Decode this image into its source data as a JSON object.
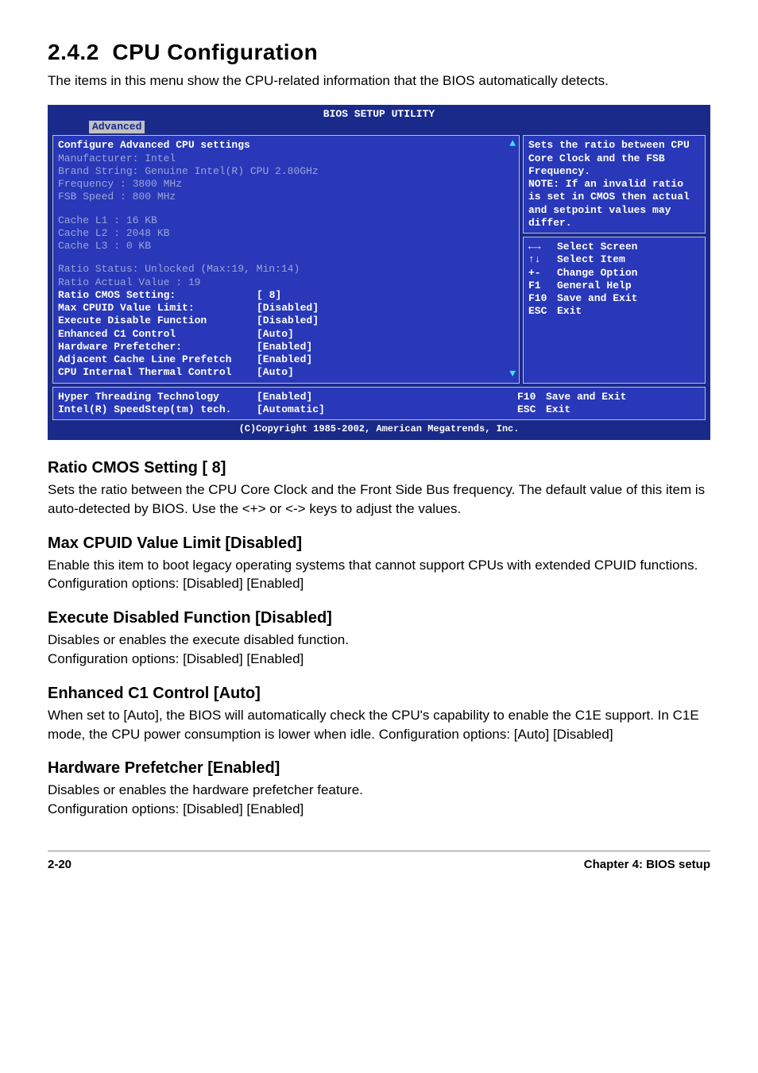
{
  "section": {
    "number": "2.4.2",
    "title": "CPU Configuration",
    "intro": "The items in this menu show the CPU-related information that the BIOS automatically detects."
  },
  "bios": {
    "title": "BIOS SETUP UTILITY",
    "tab": "Advanced",
    "left_heading": "Configure Advanced CPU settings",
    "info": {
      "manufacturer_label": "Manufacturer: Intel",
      "brand_label": "Brand String: Genuine Intel(R) CPU 2.80GHz",
      "frequency_label": "Frequency    : 3800 MHz",
      "fsb_label": "FSB Speed    : 800 MHz",
      "l1_label": "Cache L1     : 16 KB",
      "l2_label": "Cache L2     : 2048 KB",
      "l3_label": "Cache L3     : 0 KB",
      "ratio_status": "Ratio Status: Unlocked (Max:19, Min:14)",
      "ratio_actual": "Ratio Actual Value : 19"
    },
    "items": [
      {
        "label": " Ratio CMOS Setting:",
        "value": "[ 8]"
      },
      {
        "label": "Max CPUID Value Limit:",
        "value": "[Disabled]"
      },
      {
        "label": "Execute Disable Function",
        "value": "[Disabled]"
      },
      {
        "label": "Enhanced C1 Control",
        "value": "[Auto]"
      },
      {
        "label": "Hardware Prefetcher:",
        "value": "[Enabled]"
      },
      {
        "label": "Adjacent Cache Line Prefetch",
        "value": "[Enabled]"
      },
      {
        "label": "CPU Internal Thermal Control",
        "value": "[Auto]"
      }
    ],
    "extra_items": [
      {
        "label": "Hyper Threading Technology",
        "value": "[Enabled]"
      },
      {
        "label": "Intel(R) SpeedStep(tm) tech.",
        "value": "[Automatic]"
      }
    ],
    "help_text": "Sets the ratio between CPU Core Clock and the FSB Frequency.\nNOTE: If an invalid ratio is set in CMOS then actual and setpoint values may differ.",
    "nav_keys": [
      {
        "key": "←→",
        "desc": "Select Screen"
      },
      {
        "key": "↑↓",
        "desc": "Select Item"
      },
      {
        "key": "+-",
        "desc": "Change Option"
      },
      {
        "key": "F1",
        "desc": "General Help"
      },
      {
        "key": "F10",
        "desc": "Save and Exit"
      },
      {
        "key": "ESC",
        "desc": "Exit"
      }
    ],
    "extra_nav": [
      {
        "key": "F10",
        "desc": "Save and Exit"
      },
      {
        "key": "ESC",
        "desc": "Exit"
      }
    ],
    "copyright": "(C)Copyright 1985-2002, American Megatrends, Inc."
  },
  "settings": [
    {
      "heading": "Ratio CMOS Setting [ 8]",
      "body": "Sets the ratio between the CPU Core Clock and the Front Side Bus frequency. The default value of this item is auto-detected by BIOS. Use the <+> or <-> keys to adjust the values."
    },
    {
      "heading": "Max CPUID Value Limit [Disabled]",
      "body": "Enable this item to boot legacy operating systems that cannot support CPUs with extended CPUID functions.\nConfiguration options: [Disabled] [Enabled]"
    },
    {
      "heading": "Execute Disabled Function [Disabled]",
      "body": "Disables or enables the execute disabled function.\nConfiguration options: [Disabled] [Enabled]"
    },
    {
      "heading": "Enhanced C1 Control [Auto]",
      "body": "When set to [Auto], the BIOS will automatically check the CPU's capability to enable the C1E support. In C1E mode, the CPU power consumption is lower when idle. Configuration options: [Auto] [Disabled]"
    },
    {
      "heading": "Hardware Prefetcher [Enabled]",
      "body": "Disables or enables the hardware prefetcher feature.\nConfiguration options: [Disabled] [Enabled]"
    }
  ],
  "footer": {
    "left": "2-20",
    "right": "Chapter 4: BIOS setup"
  }
}
